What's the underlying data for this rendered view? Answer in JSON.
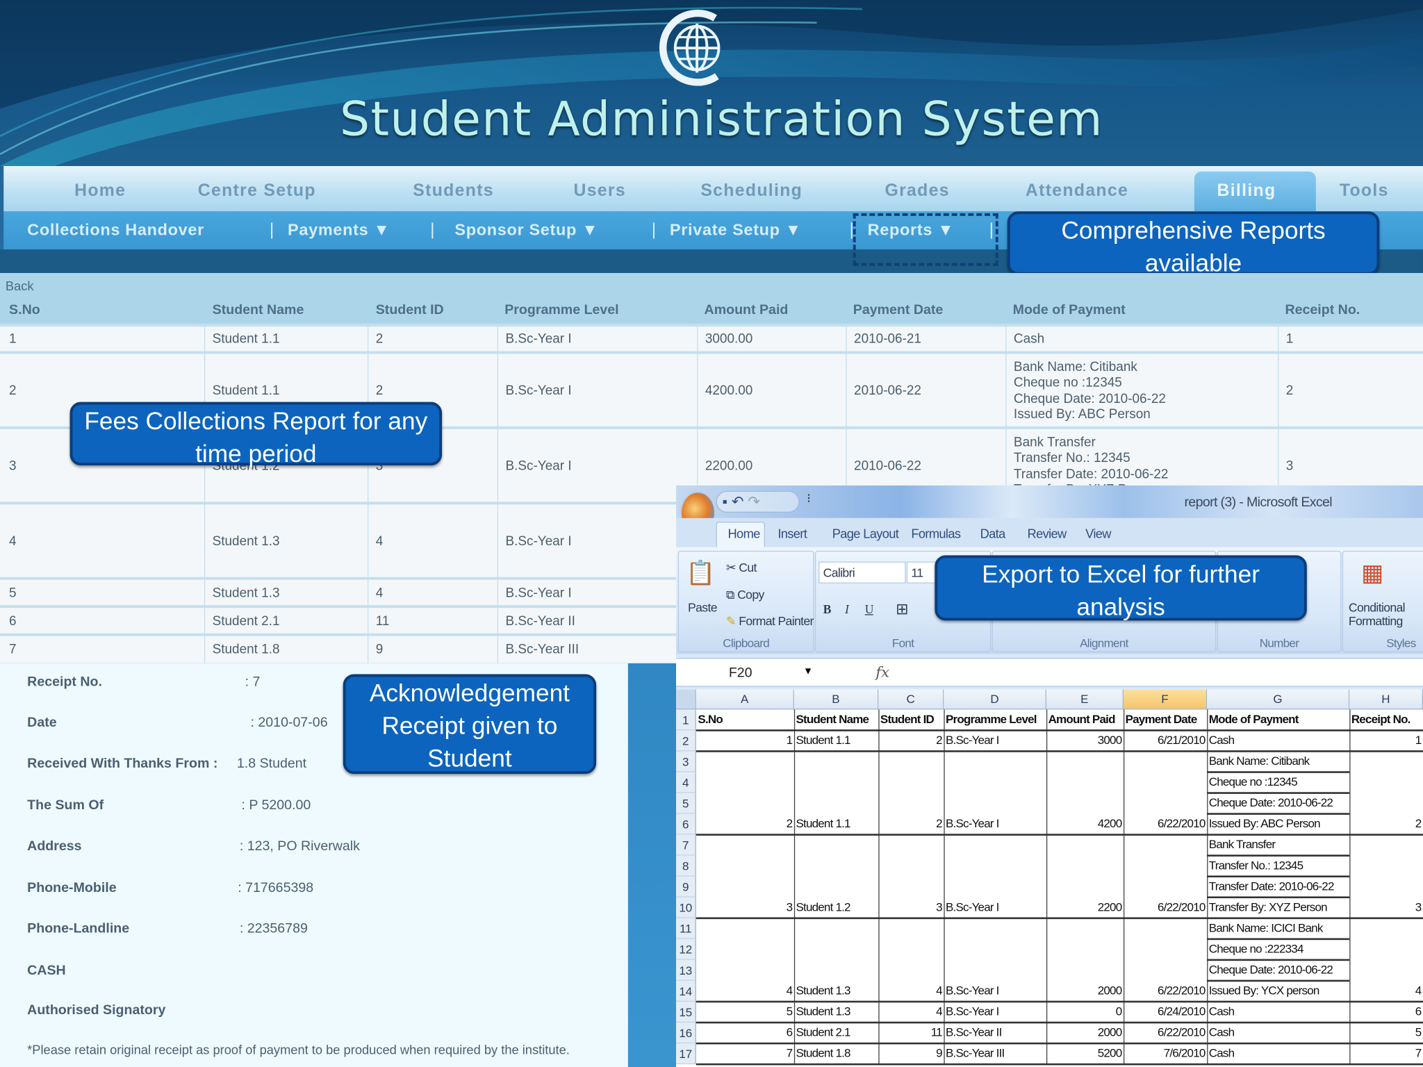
{
  "header": {
    "title": "Student Administration System"
  },
  "nav": {
    "items": [
      "Home",
      "Centre Setup",
      "Students",
      "Users",
      "Scheduling",
      "Grades",
      "Attendance",
      "Billing",
      "Tools"
    ],
    "active": "Billing"
  },
  "subnav": {
    "items": [
      "Collections Handover",
      "Payments",
      "Sponsor Setup",
      "Private Setup",
      "Reports"
    ]
  },
  "callouts": {
    "reports": "Comprehensive Reports available",
    "fees": "Fees Collections Report for any time period",
    "excel": "Export to Excel for further analysis",
    "receipt": "Acknowledgement Receipt given to Student"
  },
  "report_table": {
    "back_label": "Back",
    "columns": [
      "S.No",
      "Student Name",
      "Student ID",
      "Programme Level",
      "Amount Paid",
      "Payment Date",
      "Mode of Payment",
      "Receipt No."
    ],
    "rows": [
      {
        "sno": "1",
        "name": "Student 1.1",
        "id": "2",
        "level": "B.Sc-Year I",
        "amount": "3000.00",
        "date": "2010-06-21",
        "mode": [
          "Cash"
        ],
        "receipt": "1"
      },
      {
        "sno": "2",
        "name": "Student 1.1",
        "id": "2",
        "level": "B.Sc-Year I",
        "amount": "4200.00",
        "date": "2010-06-22",
        "mode": [
          "Bank Name: Citibank",
          "Cheque no :12345",
          "Cheque Date: 2010-06-22",
          "Issued By: ABC Person"
        ],
        "receipt": "2"
      },
      {
        "sno": "3",
        "name": "Student 1.2",
        "id": "3",
        "level": "B.Sc-Year I",
        "amount": "2200.00",
        "date": "2010-06-22",
        "mode": [
          "Bank Transfer",
          "Transfer No.: 12345",
          "Transfer Date: 2010-06-22",
          "Transfer By: XYZ Person"
        ],
        "receipt": "3"
      },
      {
        "sno": "4",
        "name": "Student 1.3",
        "id": "4",
        "level": "B.Sc-Year I"
      },
      {
        "sno": "5",
        "name": "Student 1.3",
        "id": "4",
        "level": "B.Sc-Year I"
      },
      {
        "sno": "6",
        "name": "Student 2.1",
        "id": "11",
        "level": "B.Sc-Year II"
      },
      {
        "sno": "7",
        "name": "Student 1.8",
        "id": "9",
        "level": "B.Sc-Year III"
      }
    ]
  },
  "receipt": {
    "fields": [
      {
        "label": "Receipt No.",
        "value": ":  7"
      },
      {
        "label": "Date",
        "value": ":   2010-07-06"
      },
      {
        "label": "Received With Thanks From :",
        "value": "1.8 Student"
      },
      {
        "label": "The Sum Of",
        "value": ":    P 5200.00"
      },
      {
        "label": "Address",
        "value": ":  123, PO Riverwalk"
      },
      {
        "label": "Phone-Mobile",
        "value": ": 717665398"
      },
      {
        "label": "Phone-Landline",
        "value": ":   22356789"
      }
    ],
    "payment_mode": "CASH",
    "signatory": "Authorised Signatory",
    "footnote": "*Please retain original receipt as proof of payment to be produced when required by the institute."
  },
  "excel": {
    "window_title": "report (3) - Microsoft Excel",
    "tabs": [
      "Home",
      "Insert",
      "Page Layout",
      "Formulas",
      "Data",
      "Review",
      "View"
    ],
    "ribbon": {
      "paste": "Paste",
      "cut": "Cut",
      "copy": "Copy",
      "format_painter": "Format Painter",
      "font_name": "Calibri",
      "font_size": "11",
      "bold": "B",
      "italic": "I",
      "underline": "U",
      "conditional": "Conditional",
      "formatting": "Formatting",
      "groups": [
        "Clipboard",
        "Font",
        "Alignment",
        "Number",
        "Styles"
      ]
    },
    "name_box": "F20",
    "fx": "fx",
    "col_letters": [
      "A",
      "B",
      "C",
      "D",
      "E",
      "F",
      "G",
      "H"
    ],
    "selected_col": "F",
    "rows": [
      [
        "S.No",
        "Student Name",
        "Student ID",
        "Programme Level",
        "Amount Paid",
        "Payment Date",
        "Mode of Payment",
        "Receipt No."
      ],
      [
        "1",
        "Student 1.1",
        "2",
        "B.Sc-Year I",
        "3000",
        "6/21/2010",
        "Cash",
        "1"
      ],
      [
        "",
        "",
        "",
        "",
        "",
        "",
        "Bank Name: Citibank",
        ""
      ],
      [
        "",
        "",
        "",
        "",
        "",
        "",
        "Cheque no :12345",
        ""
      ],
      [
        "",
        "",
        "",
        "",
        "",
        "",
        "Cheque Date: 2010-06-22",
        ""
      ],
      [
        "2",
        "Student 1.1",
        "2",
        "B.Sc-Year I",
        "4200",
        "6/22/2010",
        "Issued By: ABC Person",
        "2"
      ],
      [
        "",
        "",
        "",
        "",
        "",
        "",
        "Bank Transfer",
        ""
      ],
      [
        "",
        "",
        "",
        "",
        "",
        "",
        "Transfer No.: 12345",
        ""
      ],
      [
        "",
        "",
        "",
        "",
        "",
        "",
        "Transfer Date: 2010-06-22",
        ""
      ],
      [
        "3",
        "Student 1.2",
        "3",
        "B.Sc-Year I",
        "2200",
        "6/22/2010",
        "Transfer By: XYZ Person",
        "3"
      ],
      [
        "",
        "",
        "",
        "",
        "",
        "",
        "Bank Name: ICICI Bank",
        ""
      ],
      [
        "",
        "",
        "",
        "",
        "",
        "",
        "Cheque no :222334",
        ""
      ],
      [
        "",
        "",
        "",
        "",
        "",
        "",
        "Cheque Date: 2010-06-22",
        ""
      ],
      [
        "4",
        "Student 1.3",
        "4",
        "B.Sc-Year I",
        "2000",
        "6/22/2010",
        "Issued By: YCX person",
        "4"
      ],
      [
        "5",
        "Student 1.3",
        "4",
        "B.Sc-Year I",
        "0",
        "6/24/2010",
        "Cash",
        "6"
      ],
      [
        "6",
        "Student 2.1",
        "11",
        "B.Sc-Year II",
        "2000",
        "6/22/2010",
        "Cash",
        "5"
      ],
      [
        "7",
        "Student 1.8",
        "9",
        "B.Sc-Year III",
        "5200",
        "7/6/2010",
        "Cash",
        "7"
      ]
    ]
  }
}
